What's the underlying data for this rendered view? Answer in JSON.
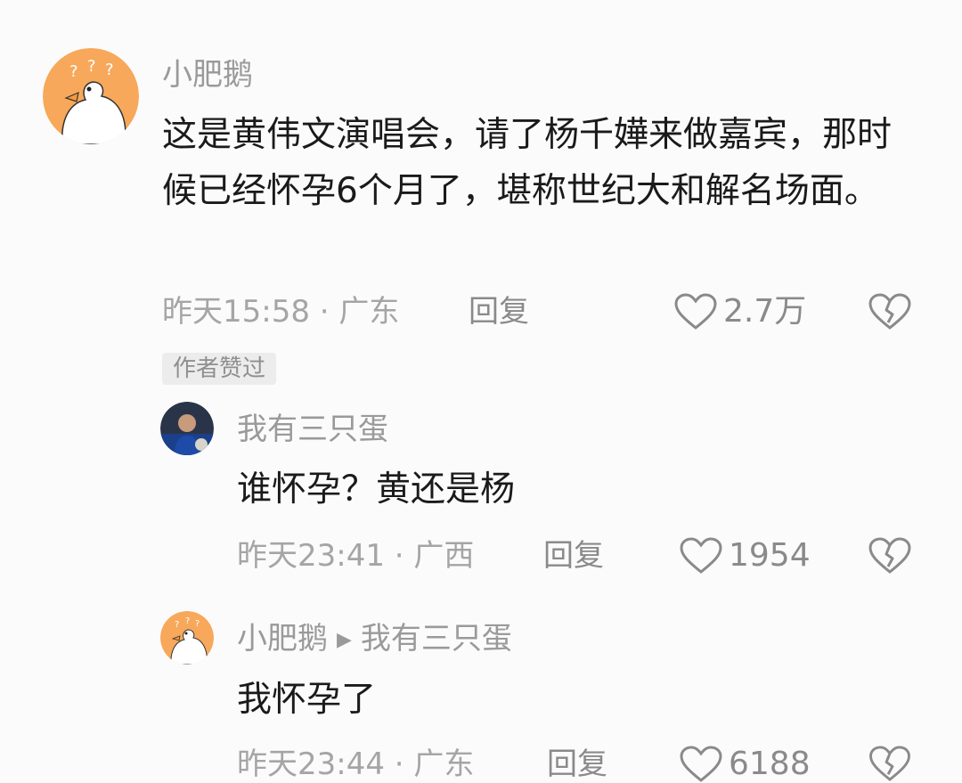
{
  "comments": [
    {
      "username": "小肥鹅",
      "text": "这是黄伟文演唱会，请了杨千嬅来做嘉宾，那时候已经怀孕6个月了，堪称世纪大和解名场面。",
      "meta": "昨天15:58 · 广东",
      "reply_label": "回复",
      "likes": "2.7万",
      "badge": "作者赞过"
    },
    {
      "username": "我有三只蛋",
      "text": "谁怀孕？黄还是杨",
      "meta": "昨天23:41 · 广西",
      "reply_label": "回复",
      "likes": "1954"
    },
    {
      "username": "小肥鹅",
      "reply_to": "我有三只蛋",
      "text": "我怀孕了",
      "meta": "昨天23:44 · 广东",
      "reply_label": "回复",
      "likes": "6188"
    }
  ],
  "icons": {
    "like": "heart-outline-icon",
    "dislike": "broken-heart-icon",
    "reply_arrow": "triangle-right-icon"
  }
}
